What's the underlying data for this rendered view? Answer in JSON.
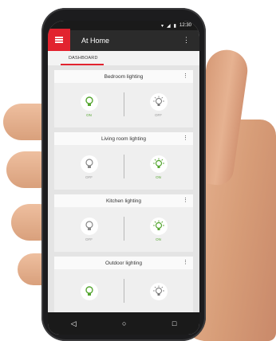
{
  "status_bar": {
    "time": "12:30"
  },
  "app_bar": {
    "title": "At Home"
  },
  "tabs": [
    {
      "label": "DASHBOARD"
    }
  ],
  "cards": [
    {
      "title": "Bedroom lighting",
      "left_state": "ON",
      "right_state": "OFF"
    },
    {
      "title": "Living room lighting",
      "left_state": "OFF",
      "right_state": "ON"
    },
    {
      "title": "Kitchen lighting",
      "left_state": "OFF",
      "right_state": "ON"
    },
    {
      "title": "Outdoor lighting",
      "left_state": "",
      "right_state": ""
    }
  ],
  "colors": {
    "accent": "#e2232f",
    "on": "#55a630",
    "off": "#999999"
  }
}
